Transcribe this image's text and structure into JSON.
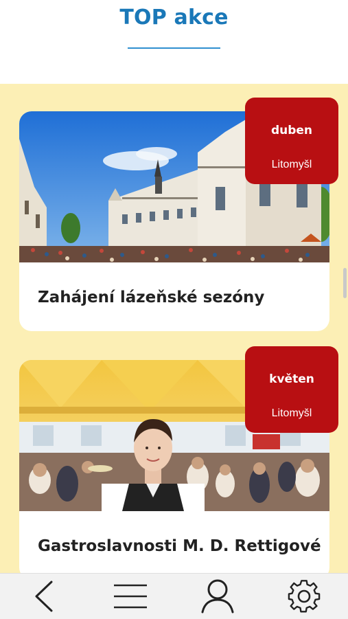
{
  "header": {
    "title": "TOP akce"
  },
  "events": [
    {
      "month": "duben",
      "place": "Litomyšl",
      "title": "Zahájení lázeňské sezóny",
      "image": "castle-square-crowd"
    },
    {
      "month": "květen",
      "place": "Litomyšl",
      "title": "Gastroslavnosti M. D. Rettigové",
      "image": "waitress-festival-tent"
    }
  ],
  "navbar": {
    "items": [
      {
        "icon": "back-icon"
      },
      {
        "icon": "menu-icon"
      },
      {
        "icon": "user-icon"
      },
      {
        "icon": "gear-icon"
      }
    ]
  },
  "colors": {
    "accent": "#1a78b8",
    "badge": "#b80f12",
    "background": "#fcefb5"
  }
}
